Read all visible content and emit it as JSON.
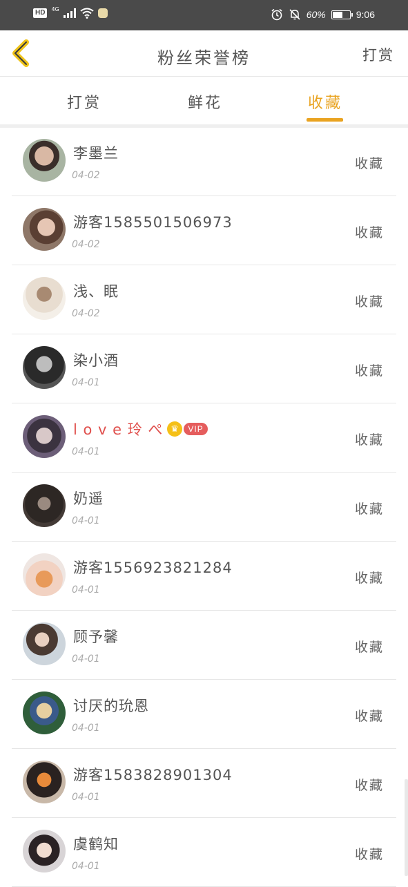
{
  "status_bar": {
    "hd": "HD",
    "network": "4G",
    "battery_text": "60%",
    "battery_level": 0.6,
    "time": "9:06",
    "icons": [
      "alarm-icon",
      "mute-icon",
      "wifi-icon",
      "signal-icon",
      "battery-icon"
    ]
  },
  "nav": {
    "title": "粉丝荣誉榜",
    "right_action": "打赏",
    "back_icon": "chevron-left-icon"
  },
  "tabs": [
    {
      "label": "打赏",
      "active": false
    },
    {
      "label": "鲜花",
      "active": false
    },
    {
      "label": "收藏",
      "active": true
    }
  ],
  "colors": {
    "accent": "#e9a320",
    "vip_name": "#e0504d",
    "status_bar": "#4a4a4a"
  },
  "list": [
    {
      "name": "李墨兰",
      "date": "04-02",
      "action": "收藏"
    },
    {
      "name": "游客1585501506973",
      "date": "04-02",
      "action": "收藏"
    },
    {
      "name": "浅、眠",
      "date": "04-02",
      "action": "收藏"
    },
    {
      "name": "染小酒",
      "date": "04-01",
      "action": "收藏"
    },
    {
      "name": "l o v e 玲 ぺ",
      "date": "04-01",
      "action": "收藏",
      "vip": "VIP"
    },
    {
      "name": "奶遥",
      "date": "04-01",
      "action": "收藏"
    },
    {
      "name": "游客1556923821284",
      "date": "04-01",
      "action": "收藏"
    },
    {
      "name": "顾予馨",
      "date": "04-01",
      "action": "收藏"
    },
    {
      "name": "讨厌的玧恩",
      "date": "04-01",
      "action": "收藏"
    },
    {
      "name": "游客1583828901304",
      "date": "04-01",
      "action": "收藏"
    },
    {
      "name": "虞鹤知",
      "date": "04-01",
      "action": "收藏"
    }
  ]
}
